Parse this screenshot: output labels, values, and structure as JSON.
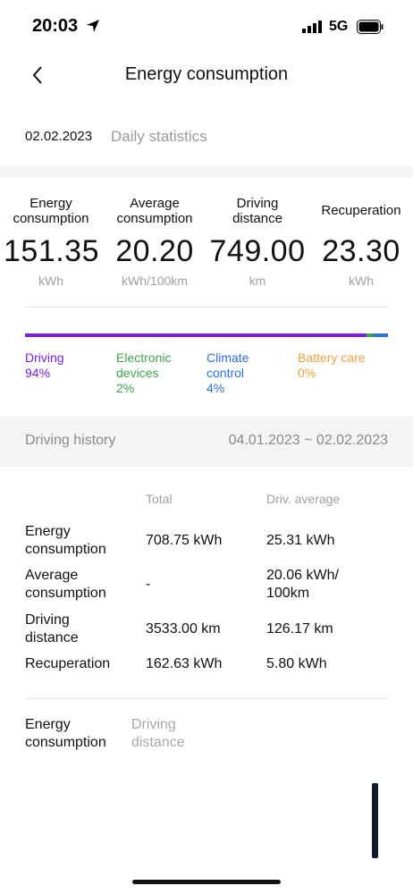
{
  "status_bar": {
    "time": "20:03",
    "network": "5G"
  },
  "nav": {
    "title": "Energy consumption"
  },
  "date_row": {
    "date": "02.02.2023",
    "mode": "Daily statistics"
  },
  "stats": [
    {
      "label_line1": "Energy",
      "label_line2": "consumption",
      "value": "151.35",
      "unit": "kWh"
    },
    {
      "label_line1": "Average",
      "label_line2": "consumption",
      "value": "20.20",
      "unit": "kWh/100km"
    },
    {
      "label_line1": "Driving",
      "label_line2": "distance",
      "value": "749.00",
      "unit": "km"
    },
    {
      "label_line1": "Recuperation",
      "label_line2": "",
      "value": "23.30",
      "unit": "kWh"
    }
  ],
  "distribution": [
    {
      "line1": "Driving",
      "line2": "94%",
      "line3": "",
      "color": "#7b1fe8",
      "fraction": 0.94
    },
    {
      "line1": "Electronic",
      "line2": "devices",
      "line3": "2%",
      "color": "#3fa34d",
      "fraction": 0.02
    },
    {
      "line1": "Climate",
      "line2": "control",
      "line3": "4%",
      "color": "#2f6fe0",
      "fraction": 0.04
    },
    {
      "line1": "Battery care",
      "line2": "0%",
      "line3": "",
      "color": "#f0a040",
      "fraction": 0.0
    }
  ],
  "history": {
    "title": "Driving history",
    "range": "04.01.2023 ~ 02.02.2023",
    "col_total": "Total",
    "col_avg": "Driv. average",
    "rows": [
      {
        "label_line1": "Energy",
        "label_line2": "consumption",
        "total": "708.75 kWh",
        "avg_line1": "25.31 kWh",
        "avg_line2": ""
      },
      {
        "label_line1": "Average",
        "label_line2": "consumption",
        "total": "-",
        "avg_line1": "20.06 kWh/",
        "avg_line2": "100km"
      },
      {
        "label_line1": "Driving",
        "label_line2": "distance",
        "total": "3533.00 km",
        "avg_line1": "126.17 km",
        "avg_line2": ""
      },
      {
        "label_line1": "Recuperation",
        "label_line2": "",
        "total": "162.63 kWh",
        "avg_line1": "5.80 kWh",
        "avg_line2": ""
      }
    ]
  },
  "tabs": [
    {
      "line1": "Energy",
      "line2": "consumption",
      "active": true
    },
    {
      "line1": "Driving",
      "line2": "distance",
      "active": false
    }
  ],
  "icons": {
    "location": "location-arrow-icon",
    "signal": "signal-icon",
    "battery": "battery-icon",
    "back": "chevron-left-icon"
  }
}
